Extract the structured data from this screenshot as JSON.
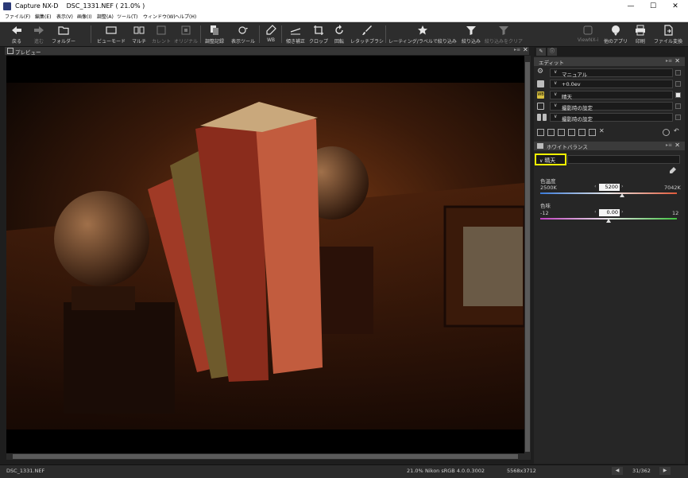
{
  "window": {
    "app_name": "Capture NX-D",
    "document": "DSC_1331.NEF ( 21.0% )",
    "minimize": "—",
    "maximize": "☐",
    "close": "✕"
  },
  "menu": [
    "ファイル(F)",
    "編集(E)",
    "表示(V)",
    "画像(I)",
    "調整(A)",
    "ツール(T)",
    "ウィンドウ(W)",
    "ヘルプ(H)"
  ],
  "toolbar": {
    "back": "戻る",
    "forward": "進む",
    "folder": "フォルダー",
    "view_mode": "ビューモード",
    "multi": "マルチ",
    "current": "カレント",
    "original": "オリジナル",
    "history": "調整記録",
    "display_tools": "表示ツール",
    "wb": "WB",
    "straighten": "傾き補正",
    "crop": "クロップ",
    "rotate": "回転",
    "retouch": "レタッチブラシ",
    "rating_filter": "レーティング/ラベルで絞り込み",
    "filter": "絞り込み",
    "clear_filter": "絞り込みをクリア",
    "viewnx": "ViewNX-i",
    "other_apps": "他のアプリ",
    "print": "印刷",
    "convert": "ファイル変換"
  },
  "preview": {
    "title": "プレビュー"
  },
  "edit_panel": {
    "title": "エディット",
    "rows": [
      {
        "value": "マニュアル",
        "icon": "gear-icon",
        "checked": false
      },
      {
        "value": "+0.0ev",
        "icon": "exposure-icon",
        "checked": false
      },
      {
        "value": "晴天",
        "icon": "wb-icon",
        "checked": true
      },
      {
        "value": "撮影時の設定",
        "icon": "picture-control-icon",
        "checked": false
      },
      {
        "value": "撮影時の設定",
        "icon": "picture-control-sub-icon",
        "checked": false
      }
    ]
  },
  "wb_panel": {
    "title": "ホワイトバランス",
    "mode": "晴天",
    "temperature": {
      "label": "色温度",
      "min": "2500K",
      "max": "7042K",
      "value": "5200",
      "position": 0.6
    },
    "tint": {
      "label": "色味",
      "min": "-12",
      "max": "12",
      "value": "0.00",
      "position": 0.5
    }
  },
  "status": {
    "filename": "DSC_1331.NEF",
    "zoom": "21.0%",
    "color_space": "Nikon sRGB 4.0.0.3002",
    "dimensions": "5568x3712",
    "count": "31/362"
  },
  "colors": {
    "highlight": "#f2f200",
    "background": "#1e1e1e"
  }
}
